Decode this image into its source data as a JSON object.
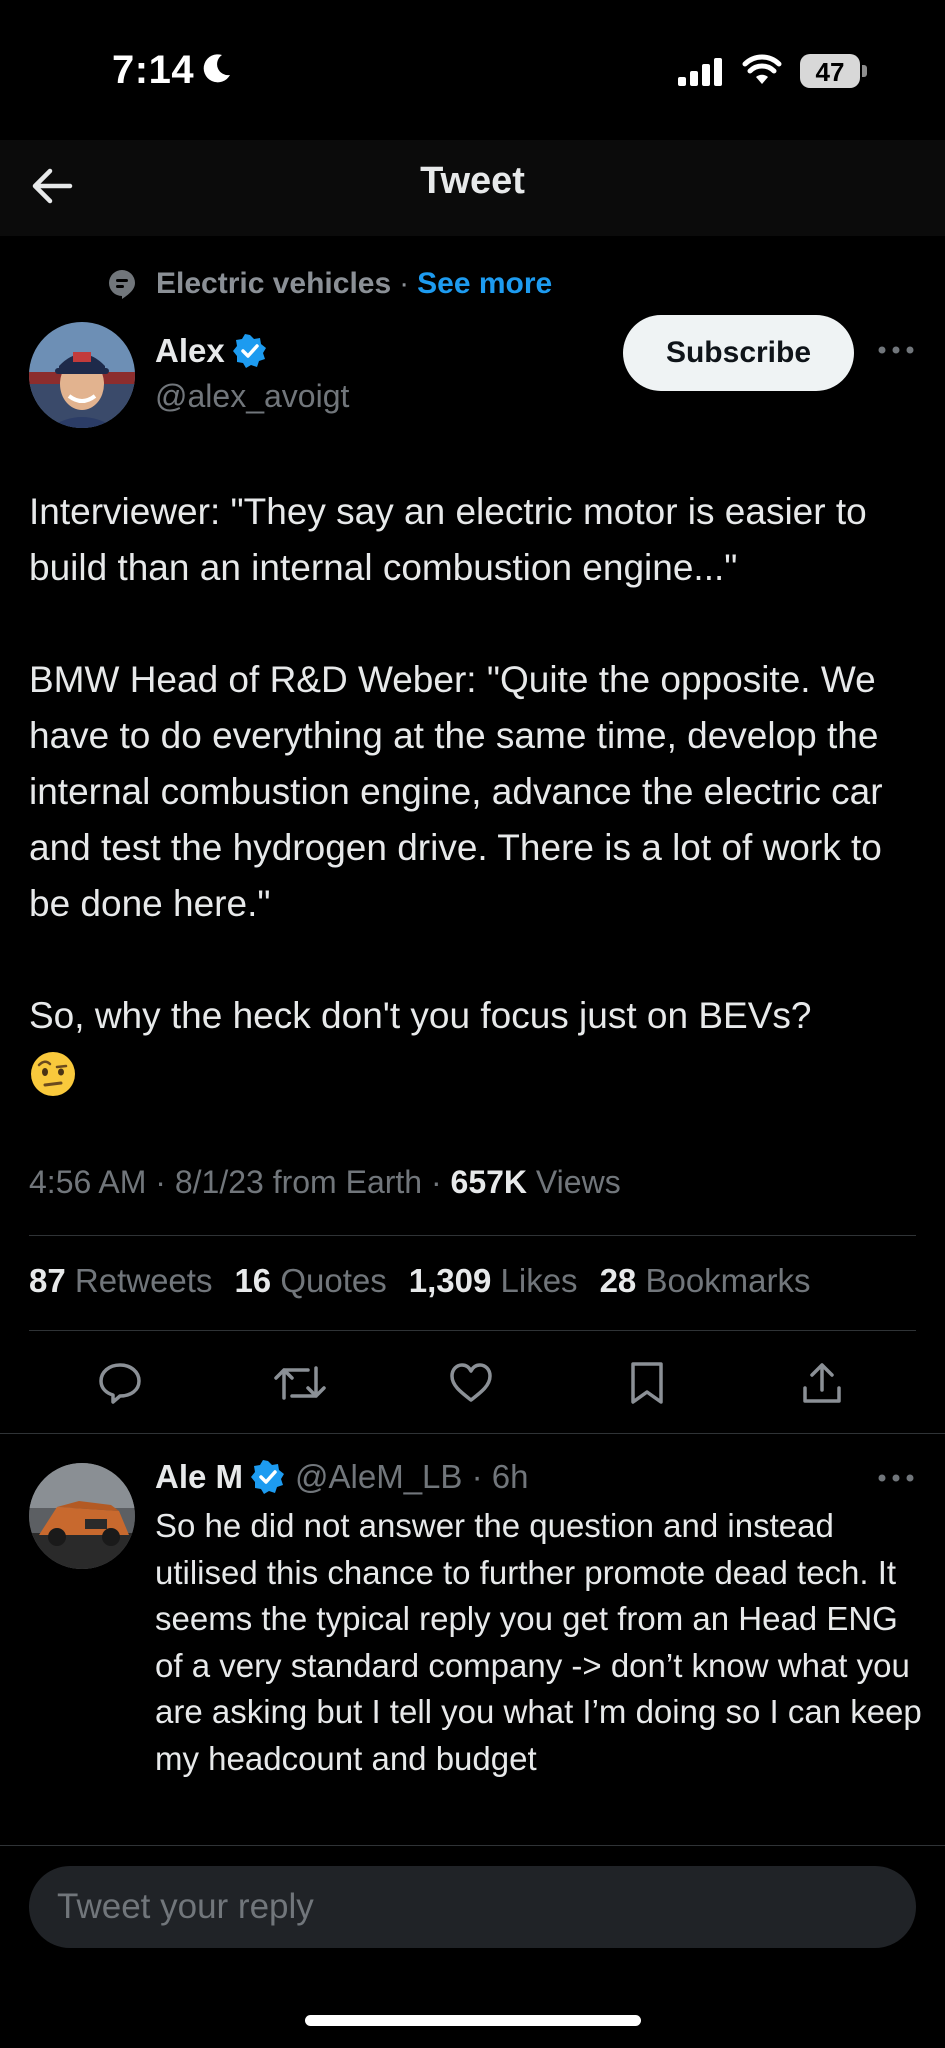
{
  "status_bar": {
    "time": "7:14",
    "battery": "47",
    "icons": [
      "moon-icon",
      "signal-icon",
      "wifi-icon",
      "battery-icon"
    ]
  },
  "header": {
    "title": "Tweet",
    "back_icon": "arrow-left-icon"
  },
  "context": {
    "topic": "Electric vehicles",
    "separator": "·",
    "see_more": "See more",
    "icon": "topic-icon"
  },
  "author": {
    "name": "Alex",
    "handle": "@alex_avoigt",
    "verified": true,
    "subscribe_label": "Subscribe"
  },
  "tweet": {
    "paragraphs": [
      "Interviewer: \"They say an electric motor is easier to build than an internal combustion engine...\"",
      "BMW Head of R&D Weber: \"Quite the opposite. We have to do everything at the same time, develop the internal combustion engine, advance the electric car and test the hydrogen drive. There is a lot of work to be done here.\"",
      "So, why the heck don't you focus just on BEVs?"
    ],
    "emoji": "face-with-raised-eyebrow"
  },
  "meta": {
    "time": "4:56 AM",
    "sep1": "·",
    "date_source": "8/1/23 from Earth",
    "sep2": "·",
    "views_count": "657K",
    "views_label": "Views"
  },
  "stats": {
    "retweets_count": "87",
    "retweets_label": "Retweets",
    "quotes_count": "16",
    "quotes_label": "Quotes",
    "likes_count": "1,309",
    "likes_label": "Likes",
    "bookmarks_count": "28",
    "bookmarks_label": "Bookmarks"
  },
  "actions": [
    "reply-icon",
    "retweet-icon",
    "like-icon",
    "bookmark-icon",
    "share-icon"
  ],
  "reply": {
    "name": "Ale M",
    "verified": true,
    "handle_time": "@AleM_LB · 6h",
    "text": "So he did not answer the question and instead utilised this chance to further promote dead tech. It seems the typical reply you get from an Head ENG of a very standard company -> don’t know what you are asking but I tell you what I’m doing so I can keep my headcount and budget"
  },
  "composer": {
    "placeholder": "Tweet your reply"
  },
  "colors": {
    "background": "#000000",
    "accent": "#1d9bf0",
    "text": "#e7e9ea",
    "muted": "#71767b",
    "divider": "#2f3336"
  }
}
